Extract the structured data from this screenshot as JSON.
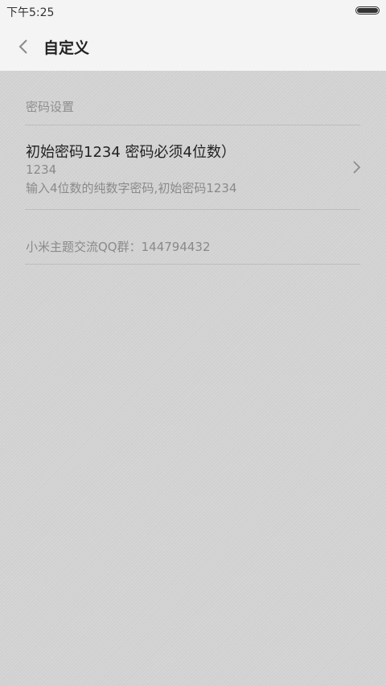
{
  "status_bar": {
    "time": "下午5:25"
  },
  "header": {
    "title": "自定义"
  },
  "section": {
    "header": "密码设置"
  },
  "password_item": {
    "title": "初始密码1234 密码必须4位数）",
    "value": "1234",
    "summary": "输入4位数的纯数字密码,初始密码1234"
  },
  "info": {
    "text": "小米主题交流QQ群：144794432"
  },
  "icons": {
    "back": "chevron-left-icon",
    "arrow": "chevron-right-icon",
    "battery": "battery-icon"
  },
  "colors": {
    "background": "#d3d3d3",
    "bar": "#f4f4f4",
    "primary_text": "#222222",
    "secondary_text": "#8a8a8a"
  }
}
